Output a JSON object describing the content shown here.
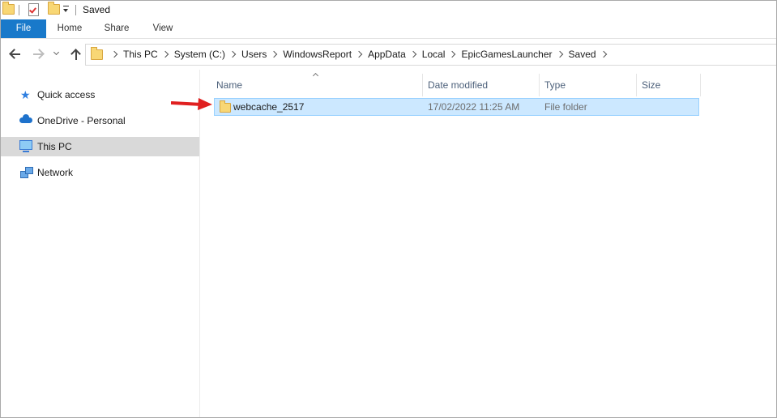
{
  "titlebar": {
    "title": "Saved"
  },
  "ribbon": {
    "tabs": [
      {
        "label": "File",
        "active": true
      },
      {
        "label": "Home"
      },
      {
        "label": "Share"
      },
      {
        "label": "View"
      }
    ]
  },
  "address": {
    "crumbs": [
      "This PC",
      "System (C:)",
      "Users",
      "WindowsReport",
      "AppData",
      "Local",
      "EpicGamesLauncher",
      "Saved"
    ]
  },
  "navpane": {
    "items": [
      {
        "label": "Quick access",
        "icon": "star-icon"
      },
      {
        "label": "OneDrive - Personal",
        "icon": "cloud-icon"
      },
      {
        "label": "This PC",
        "icon": "computer-icon",
        "selected": true
      },
      {
        "label": "Network",
        "icon": "network-icon"
      }
    ]
  },
  "filelist": {
    "columns": [
      "Name",
      "Date modified",
      "Type",
      "Size"
    ],
    "rows": [
      {
        "name": "webcache_2517",
        "date_modified": "17/02/2022 11:25 AM",
        "type": "File folder",
        "size": "",
        "selected": true
      }
    ]
  },
  "colors": {
    "accent": "#1979ca",
    "selection_bg": "#cce8ff",
    "selection_border": "#99d1ff",
    "annotation_arrow": "#e02020"
  }
}
